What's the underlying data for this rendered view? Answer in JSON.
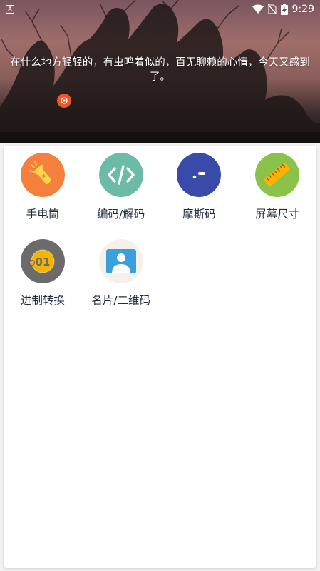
{
  "status_bar": {
    "app_indicator": "A",
    "time": "9:29",
    "icons": [
      "wifi-icon",
      "no-sim-icon",
      "battery-charging-icon"
    ]
  },
  "banner": {
    "quote": "在什么地方轻轻的，有虫鸣着似的，百无聊赖的心情，今天又感到了。",
    "refresh_icon": "refresh-icon"
  },
  "tools": [
    {
      "label": "手电筒",
      "icon": "flashlight-icon",
      "color": "#f57f3c"
    },
    {
      "label": "编码/解码",
      "icon": "code-icon",
      "color": "#6cbba9"
    },
    {
      "label": "摩斯码",
      "icon": "morse-icon",
      "color": "#3a4aa8"
    },
    {
      "label": "屏幕尺寸",
      "icon": "ruler-icon",
      "color": "#8bc34a"
    },
    {
      "label": "进制转换",
      "icon": "base-convert-icon",
      "color": "#6b6b6b"
    },
    {
      "label": "名片/二维码",
      "icon": "business-card-icon",
      "color": "#f4f1ea"
    }
  ]
}
